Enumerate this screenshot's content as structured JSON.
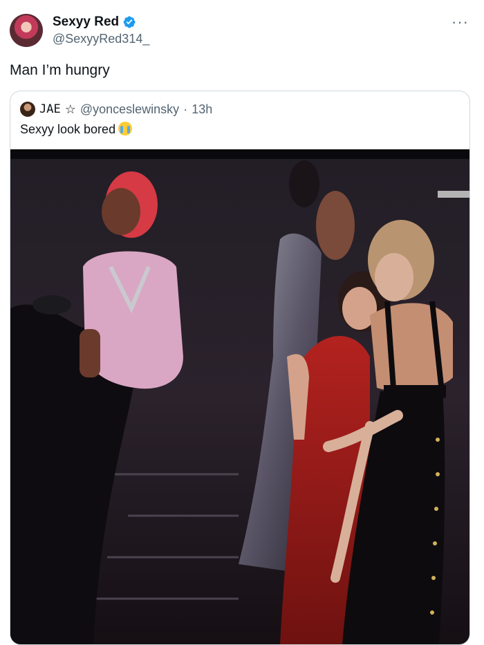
{
  "tweet": {
    "display_name": "Sexyy Red",
    "handle": "@SexyyRed314_",
    "more_icon": "more-horizontal-icon",
    "text": "Man I’m hungry",
    "verified": true
  },
  "quoted_tweet": {
    "display_name": "JAE",
    "handle": "@yonceslewinsky",
    "separator": "·",
    "time": "13h",
    "text": "Sexyy look bored",
    "emoji": "loudly-crying-face-icon"
  },
  "colors": {
    "text_primary": "#0f1419",
    "text_secondary": "#536471",
    "border": "#cfd9de",
    "verified_blue": "#1d9bf0"
  }
}
